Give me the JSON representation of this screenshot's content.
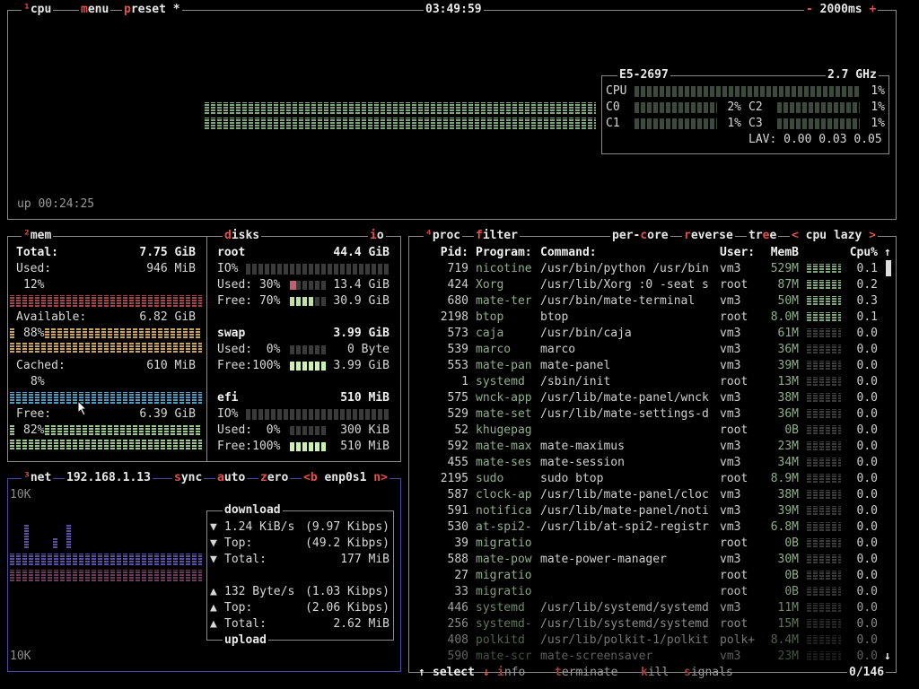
{
  "cpu_panel": {
    "superscript": "¹",
    "title": "cpu",
    "menu_key": "m",
    "menu_rest": "enu",
    "preset_key": "p",
    "preset_rest": "reset *",
    "clock": "03:49:59",
    "rate_minus": "-",
    "rate": "2000ms",
    "rate_plus": "+",
    "uptime": "up 00:24:25",
    "cpu_model": "E5-2697",
    "cpu_freq": "2.7 GHz",
    "cores": [
      {
        "name": "CPU",
        "pct": "1%"
      },
      {
        "name": "C0",
        "pct": "2%"
      },
      {
        "name": "C1",
        "pct": "1%"
      },
      {
        "name": "C2",
        "pct": "1%"
      },
      {
        "name": "C3",
        "pct": "1%"
      }
    ],
    "lav": "LAV: 0.00 0.03 0.05"
  },
  "mem_panel": {
    "superscript": "²",
    "title": "mem",
    "total_label": "Total:",
    "total_value": "7.75 GiB",
    "used_label": "Used:",
    "used_value": "946 MiB",
    "used_pct": "12%",
    "available_label": "Available:",
    "available_value": "6.82 GiB",
    "available_pct": "88%",
    "cached_label": "Cached:",
    "cached_value": "610 MiB",
    "cached_pct": "8%",
    "free_label": "Free:",
    "free_value": "6.39 GiB",
    "free_pct": "82%"
  },
  "disks_panel": {
    "title_key": "d",
    "title_rest": "isks",
    "io_key": "i",
    "io_rest": "o",
    "groups": [
      {
        "name": "root",
        "size": "44.4 GiB",
        "io_label": "IO%",
        "used": "Used: 30%",
        "used_value": "13.4 GiB",
        "free": "Free: 70%",
        "free_value": "30.9 GiB"
      },
      {
        "name": "swap",
        "size": "3.99 GiB",
        "used": "Used:  0%",
        "used_value": "0 Byte",
        "free": "Free:100%",
        "free_value": "3.99 GiB"
      },
      {
        "name": "efi",
        "size": "510 MiB",
        "io_label": "IO%",
        "used": "Used:  0%",
        "used_value": "300 KiB",
        "free": "Free:100%",
        "free_value": "510 MiB"
      }
    ]
  },
  "net_panel": {
    "superscript": "³",
    "title": "net",
    "ip": "192.168.1.13",
    "sync_key": "s",
    "sync_rest": "ync",
    "auto_key": "a",
    "auto_rest": "uto",
    "zero_key": "z",
    "zero_rest": "ero",
    "prev": "<b",
    "iface": "enp0s1",
    "next": "n>",
    "scale_top": "10K",
    "scale_bottom": "10K",
    "download_title": "download",
    "upload_title": "upload",
    "download_rate": "1.24 KiB/s",
    "download_kbps": "(9.97 Kibps)",
    "download_top_label": "Top:",
    "download_top": "(49.2 Kibps)",
    "download_total_label": "Total:",
    "download_total": "177 MiB",
    "upload_rate": "132 Byte/s",
    "upload_kbps": "(1.03 Kibps)",
    "upload_top_label": "Top:",
    "upload_top": "(2.06 Kibps)",
    "upload_total_label": "Total:",
    "upload_total": "2.62 MiB",
    "down_arrow": "▼",
    "up_arrow": "▲"
  },
  "proc_panel": {
    "superscript": "⁴",
    "title": "proc",
    "filter_key": "f",
    "filter_rest": "ilter",
    "percore_a": "per-",
    "percore_key": "c",
    "percore_b": "ore",
    "reverse_key": "r",
    "reverse_rest": "everse",
    "tree_a": "tr",
    "tree_key": "e",
    "tree_b": "e",
    "sort_prev": "<",
    "sort": "cpu lazy",
    "sort_next": ">",
    "scroll_up": "↑",
    "scroll_down": "↓",
    "headers": {
      "pid": "Pid:",
      "program": "Program:",
      "command": "Command:",
      "user": "User:",
      "mem": "MemB",
      "cpu": "Cpu%"
    },
    "rows": [
      {
        "pid": "719",
        "program": "nicotine",
        "command": "/usr/bin/python /usr/bin",
        "user": "vm3",
        "mem": "529M",
        "cpu": "0.1"
      },
      {
        "pid": "424",
        "program": "Xorg",
        "command": "/usr/lib/Xorg :0 -seat s",
        "user": "root",
        "mem": "87M",
        "cpu": "0.2"
      },
      {
        "pid": "680",
        "program": "mate-ter",
        "command": "/usr/bin/mate-terminal",
        "user": "vm3",
        "mem": "50M",
        "cpu": "0.3"
      },
      {
        "pid": "2198",
        "program": "btop",
        "command": "btop",
        "user": "root",
        "mem": "8.0M",
        "cpu": "0.1"
      },
      {
        "pid": "573",
        "program": "caja",
        "command": "/usr/bin/caja",
        "user": "vm3",
        "mem": "61M",
        "cpu": "0.0"
      },
      {
        "pid": "539",
        "program": "marco",
        "command": "marco",
        "user": "vm3",
        "mem": "36M",
        "cpu": "0.0"
      },
      {
        "pid": "553",
        "program": "mate-pan",
        "command": "mate-panel",
        "user": "vm3",
        "mem": "39M",
        "cpu": "0.0"
      },
      {
        "pid": "1",
        "program": "systemd",
        "command": "/sbin/init",
        "user": "root",
        "mem": "13M",
        "cpu": "0.0"
      },
      {
        "pid": "575",
        "program": "wnck-app",
        "command": "/usr/lib/mate-panel/wnck",
        "user": "vm3",
        "mem": "38M",
        "cpu": "0.0"
      },
      {
        "pid": "529",
        "program": "mate-set",
        "command": "/usr/lib/mate-settings-d",
        "user": "vm3",
        "mem": "36M",
        "cpu": "0.0"
      },
      {
        "pid": "52",
        "program": "khugepag",
        "command": "",
        "user": "root",
        "mem": "0B",
        "cpu": "0.0"
      },
      {
        "pid": "592",
        "program": "mate-max",
        "command": "mate-maximus",
        "user": "vm3",
        "mem": "23M",
        "cpu": "0.0"
      },
      {
        "pid": "455",
        "program": "mate-ses",
        "command": "mate-session",
        "user": "vm3",
        "mem": "34M",
        "cpu": "0.0"
      },
      {
        "pid": "2195",
        "program": "sudo",
        "command": "sudo btop",
        "user": "root",
        "mem": "8.9M",
        "cpu": "0.0"
      },
      {
        "pid": "587",
        "program": "clock-ap",
        "command": "/usr/lib/mate-panel/cloc",
        "user": "vm3",
        "mem": "38M",
        "cpu": "0.0"
      },
      {
        "pid": "591",
        "program": "notifica",
        "command": "/usr/lib/mate-panel/noti",
        "user": "vm3",
        "mem": "39M",
        "cpu": "0.0"
      },
      {
        "pid": "530",
        "program": "at-spi2-",
        "command": "/usr/lib/at-spi2-registr",
        "user": "vm3",
        "mem": "6.8M",
        "cpu": "0.0"
      },
      {
        "pid": "39",
        "program": "migratio",
        "command": "",
        "user": "root",
        "mem": "0B",
        "cpu": "0.0"
      },
      {
        "pid": "588",
        "program": "mate-pow",
        "command": "mate-power-manager",
        "user": "vm3",
        "mem": "30M",
        "cpu": "0.0"
      },
      {
        "pid": "27",
        "program": "migratio",
        "command": "",
        "user": "root",
        "mem": "0B",
        "cpu": "0.0"
      },
      {
        "pid": "33",
        "program": "migratio",
        "command": "",
        "user": "root",
        "mem": "0B",
        "cpu": "0.0"
      },
      {
        "pid": "446",
        "program": "systemd",
        "command": "/usr/lib/systemd/systemd",
        "user": "vm3",
        "mem": "11M",
        "cpu": "0.0"
      },
      {
        "pid": "256",
        "program": "systemd-",
        "command": "/usr/lib/systemd/systemd",
        "user": "root",
        "mem": "15M",
        "cpu": "0.0"
      },
      {
        "pid": "408",
        "program": "polkitd",
        "command": "/usr/lib/polkit-1/polkit",
        "user": "polk+",
        "mem": "8.4M",
        "cpu": "0.0"
      },
      {
        "pid": "590",
        "program": "mate-scr",
        "command": "mate-screensaver",
        "user": "vm3",
        "mem": "23M",
        "cpu": "0.0"
      }
    ],
    "footer": {
      "up": "↑",
      "select": "select",
      "down": "↓",
      "info_key": "i",
      "info_rest": "nfo",
      "terminate_key": "t",
      "terminate_rest": "erminate",
      "kill_key": "k",
      "kill_rest": "ill",
      "signals_key": "s",
      "signals_rest": "ignals",
      "count": "0/146"
    }
  },
  "colors": {
    "border": "#8a8a8a",
    "hotkey": "#e2514c",
    "cpu_graph": "#7fa77c",
    "mem_used": "#a24648",
    "mem_available": "#c9a45c",
    "mem_cached": "#4f9bbf",
    "mem_free": "#9bc68c",
    "net_download": "#5b4fa3",
    "net_upload": "#6a3a5a"
  }
}
